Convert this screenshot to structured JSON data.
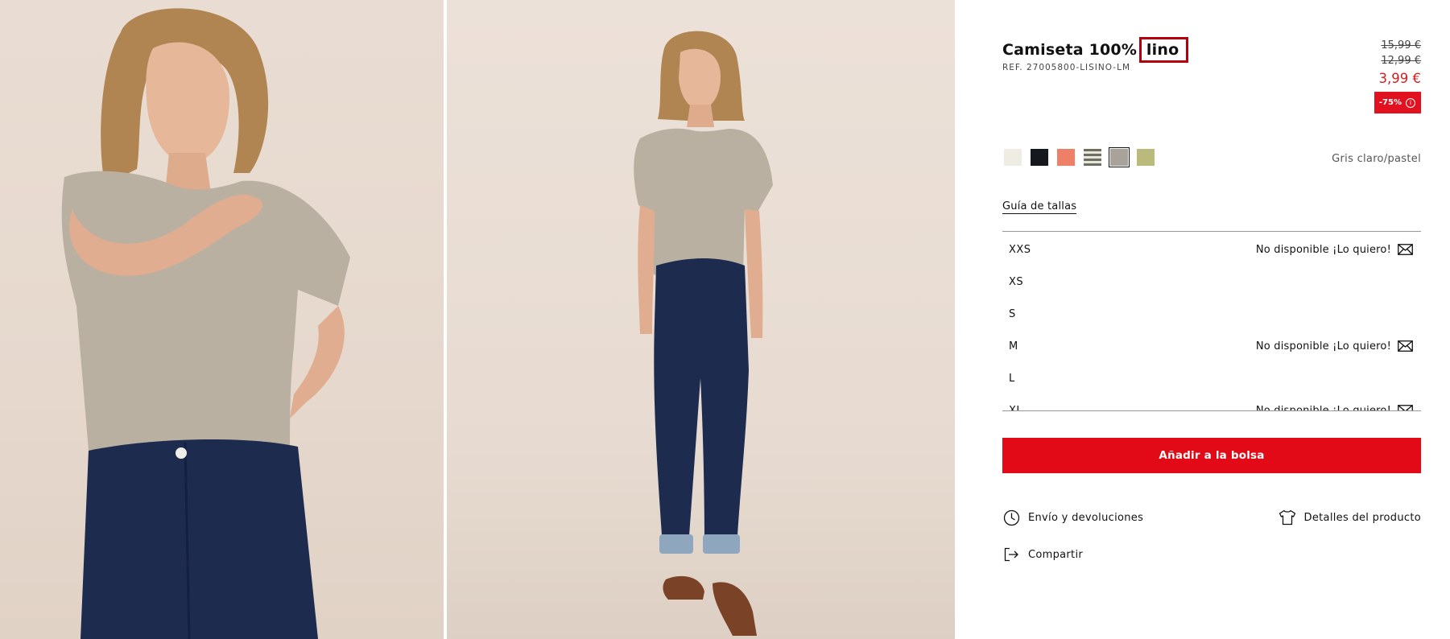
{
  "product": {
    "title_prefix": "Camiseta 100%",
    "title_highlight": "lino",
    "reference": "REF. 27005800-LISINO-LM"
  },
  "prices": {
    "original_1": "15,99 €",
    "original_2": "12,99 €",
    "current": "3,99 €",
    "discount": "-75%",
    "discount_info_icon": "info-icon"
  },
  "colors": {
    "swatches": [
      {
        "name": "crudo",
        "hex": "#efece4"
      },
      {
        "name": "negro",
        "hex": "#15181d"
      },
      {
        "name": "coral",
        "hex": "#ee8068"
      },
      {
        "name": "rayas",
        "hex": "#8f8f80"
      },
      {
        "name": "gris-claro-pastel",
        "hex": "#a9a29a",
        "selected": true
      },
      {
        "name": "verde",
        "hex": "#b9ba7c"
      }
    ],
    "selected_label": "Gris claro/pastel"
  },
  "size_guide_label": "Guía de tallas",
  "sizes": [
    {
      "label": "XXS",
      "status": "No disponible ¡Lo quiero!"
    },
    {
      "label": "XS",
      "status": ""
    },
    {
      "label": "S",
      "status": ""
    },
    {
      "label": "M",
      "status": "No disponible ¡Lo quiero!"
    },
    {
      "label": "L",
      "status": ""
    },
    {
      "label": "XL",
      "status": "No disponible ¡Lo quiero!"
    }
  ],
  "add_to_bag_label": "Añadir a la bolsa",
  "links": {
    "shipping": "Envío y devoluciones",
    "details": "Detalles del producto",
    "share": "Compartir"
  },
  "colors_theme": {
    "accent_red": "#e20a16",
    "price_red": "#d41d1d",
    "highlight_border": "#b5000c"
  }
}
